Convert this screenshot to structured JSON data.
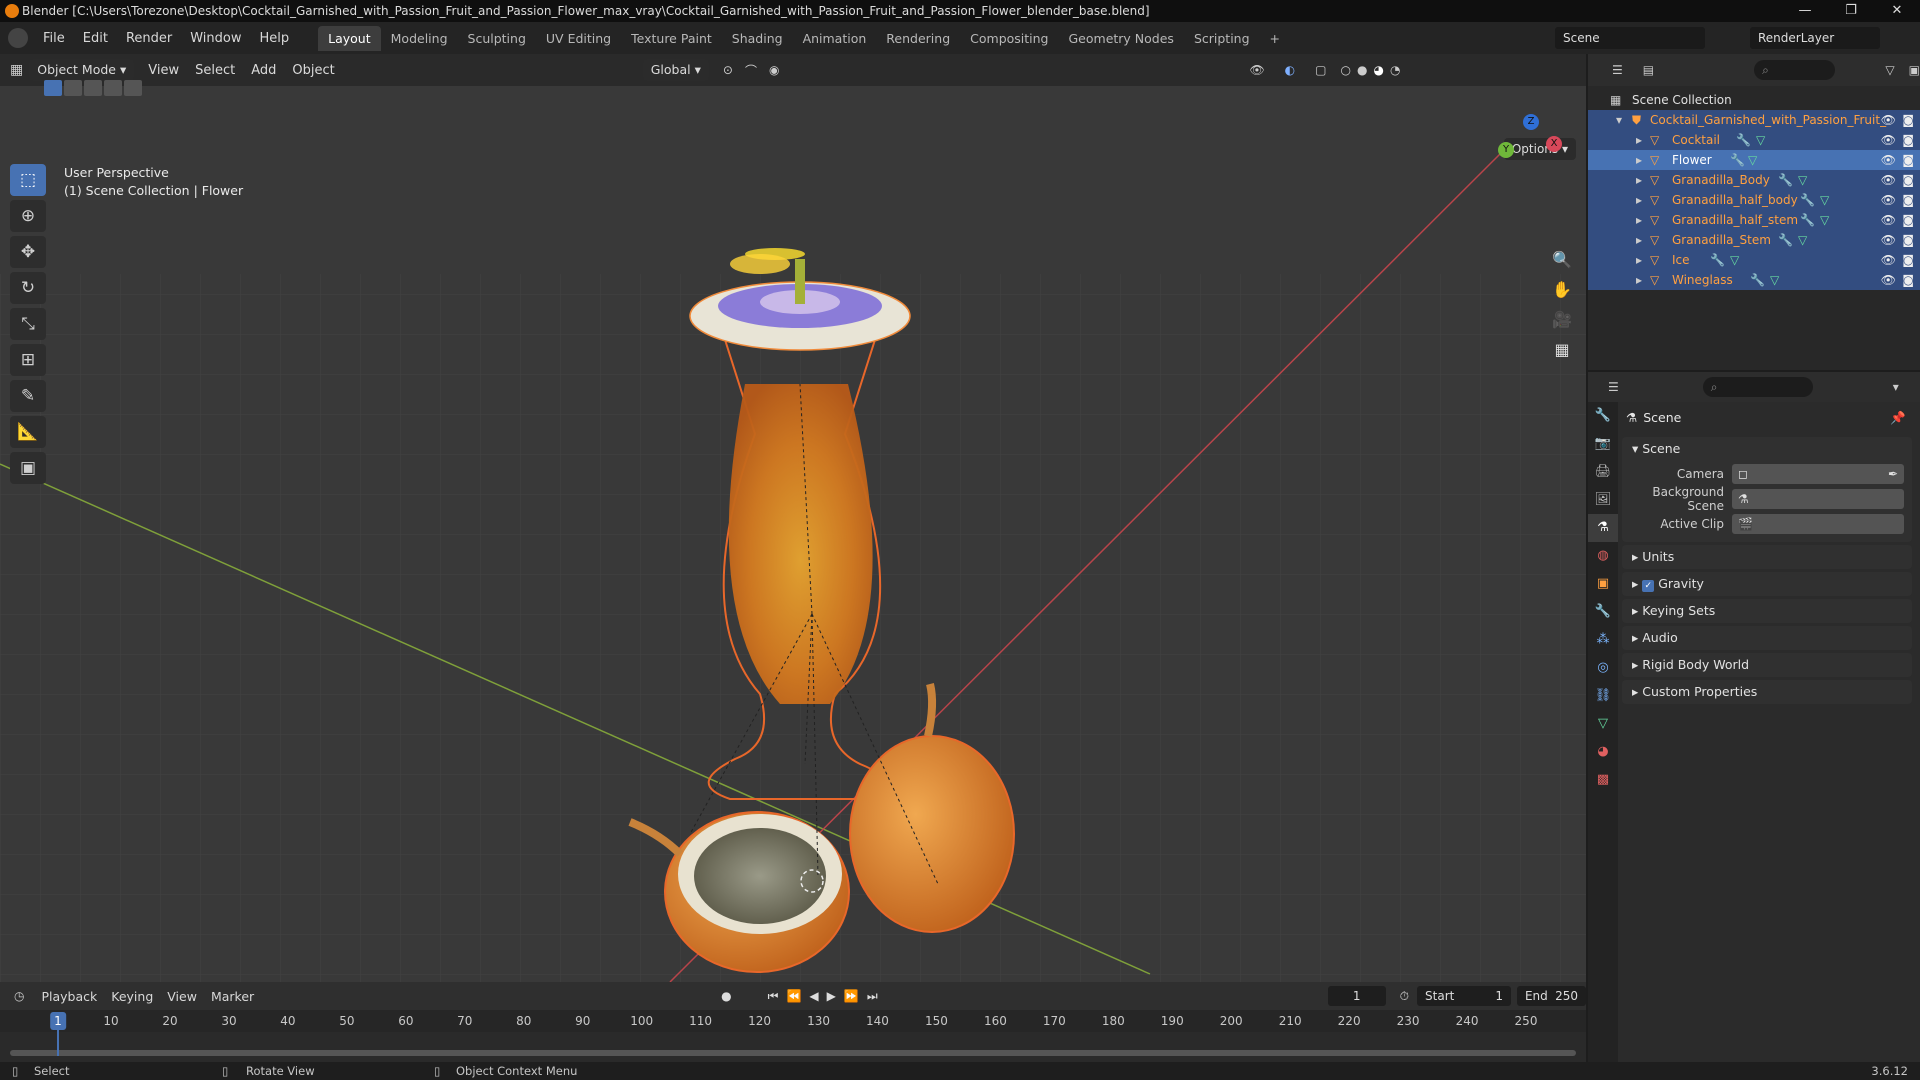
{
  "window": {
    "title": "Blender [C:\\Users\\Torezone\\Desktop\\Cocktail_Garnished_with_Passion_Fruit_and_Passion_Flower_max_vray\\Cocktail_Garnished_with_Passion_Fruit_and_Passion_Flower_blender_base.blend]",
    "min": "—",
    "max": "❐",
    "close": "✕"
  },
  "menu": [
    "File",
    "Edit",
    "Render",
    "Window",
    "Help"
  ],
  "workspaces": [
    "Layout",
    "Modeling",
    "Sculpting",
    "UV Editing",
    "Texture Paint",
    "Shading",
    "Animation",
    "Rendering",
    "Compositing",
    "Geometry Nodes",
    "Scripting",
    "+"
  ],
  "scene_name": "Scene",
  "view_layer": "RenderLayer",
  "viewport": {
    "mode": "Object Mode",
    "menus": [
      "View",
      "Select",
      "Add",
      "Object"
    ],
    "transform": "Global",
    "options_label": "Options",
    "info_line1": "User Perspective",
    "info_line2": "(1) Scene Collection | Flower",
    "gizmo": {
      "x": "X",
      "y": "Y",
      "z": "Z"
    }
  },
  "outliner": {
    "root": "Scene Collection",
    "collection": "Cocktail_Garnished_with_Passion_Fruit_",
    "objects": [
      "Cocktail",
      "Flower",
      "Granadilla_Body",
      "Granadilla_half_body",
      "Granadilla_half_stem",
      "Granadilla_Stem",
      "Ice",
      "Wineglass"
    ]
  },
  "properties": {
    "context_title": "Scene",
    "panel_scene": "Scene",
    "camera_label": "Camera",
    "background_scene_label": "Background Scene",
    "active_clip_label": "Active Clip",
    "sections": [
      "Units",
      "Gravity",
      "Keying Sets",
      "Audio",
      "Rigid Body World",
      "Custom Properties"
    ]
  },
  "timeline": {
    "menus": [
      "Playback",
      "Keying",
      "View",
      "Marker"
    ],
    "current_frame": "1",
    "start_label": "Start",
    "start": "1",
    "end_label": "End",
    "end": "250",
    "ticks": [
      "1",
      "10",
      "20",
      "30",
      "40",
      "50",
      "60",
      "70",
      "80",
      "90",
      "100",
      "110",
      "120",
      "130",
      "140",
      "150",
      "160",
      "170",
      "180",
      "190",
      "200",
      "210",
      "220",
      "230",
      "240",
      "250"
    ]
  },
  "status": {
    "select": "Select",
    "rotate": "Rotate View",
    "context_menu": "Object Context Menu",
    "version": "3.6.12"
  }
}
